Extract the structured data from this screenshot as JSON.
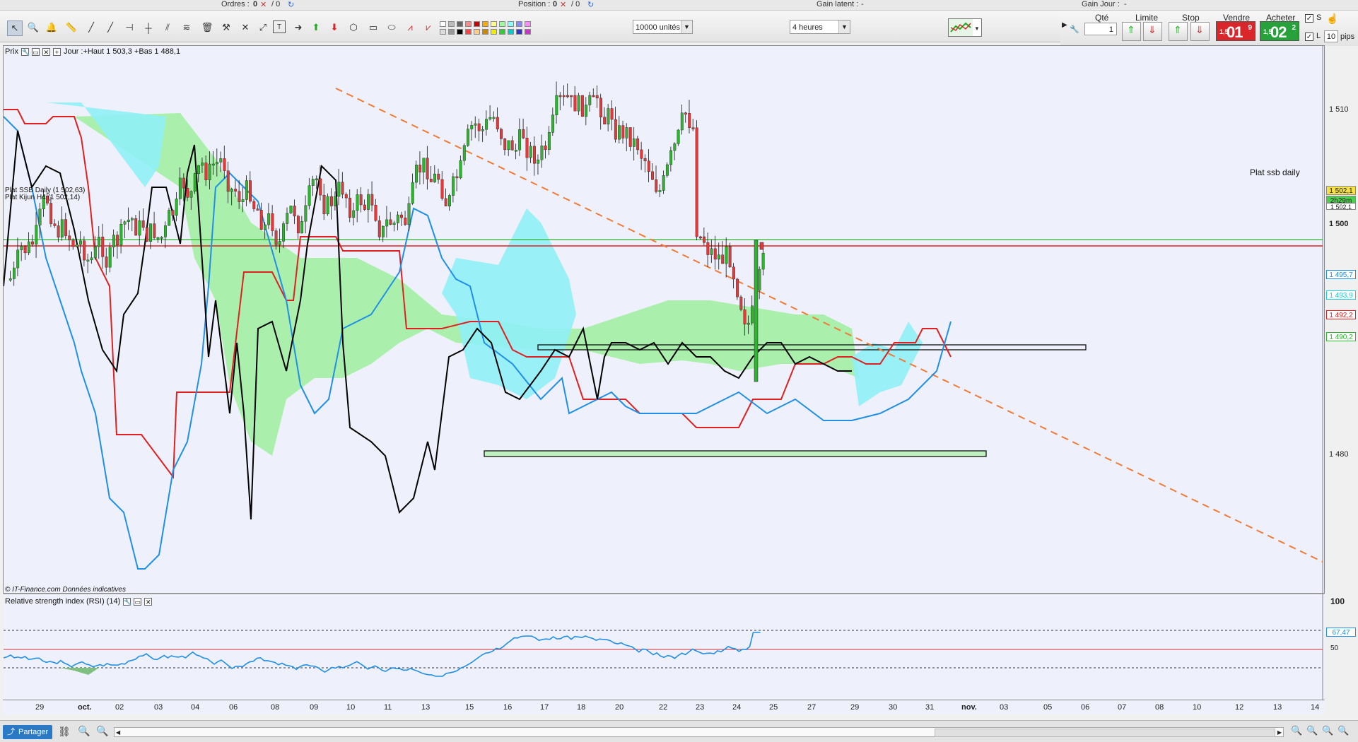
{
  "topbar": {
    "orders": "Ordres :",
    "orders_val": "0",
    "orders_of": "/ 0",
    "position": "Position :",
    "position_val": "0",
    "position_of": "/ 0",
    "gain_latent": "Gain latent :",
    "gain_latent_val": "-",
    "gain_jour": "Gain Jour :",
    "gain_jour_val": "-"
  },
  "toolbar": {
    "units": "10000 unités",
    "period": "4 heures"
  },
  "order_panel": {
    "qty_label": "Qté",
    "qty_value": "1",
    "limit_label": "Limite",
    "stop_label": "Stop",
    "sell_label": "Vendre",
    "buy_label": "Acheter",
    "sell_small": "1,5",
    "sell_big": "01",
    "sell_sup": "9",
    "buy_small": "1,5",
    "buy_big": "02",
    "buy_sup": "2",
    "s_label": "S",
    "l_label": "L",
    "pips_value": "10",
    "pips_label": "pips"
  },
  "chart": {
    "legend_name": "Prix",
    "legend_info": "Jour :+Haut 1 503,3 +Bas 1 488,1",
    "line1_label": "Plat SSB Daily (1 502,63)",
    "line2_label": "Plat Kijun H4 (1 502,14)",
    "annotation": "Plat ssb daily",
    "source": "© IT-Finance.com  Données indicatives",
    "y_ticks": [
      "1 510",
      "1 500",
      "1 480"
    ],
    "tags": {
      "price": "1 502,1",
      "timer": "2h29m",
      "t3": "1 502,1",
      "t4": "1 495,7",
      "t5": "1 493,9",
      "t6": "1 492,2",
      "t7": "1 490,2"
    },
    "colors": {
      "up": "#2db52d",
      "down": "#e23a3a",
      "kijun": "#e02020",
      "tenkan": "#1f8fe8",
      "chikou": "#000000",
      "cloud_up": "#9ef09e",
      "cloud_down": "#8ff0f5",
      "trend": "#f07a36"
    }
  },
  "rsi": {
    "label": "Relative strength index (RSI) (14)",
    "ticks": [
      "100",
      "50"
    ],
    "value": "67,47"
  },
  "xaxis": [
    "29",
    "oct.",
    "02",
    "03",
    "04",
    "06",
    "08",
    "09",
    "10",
    "11",
    "13",
    "15",
    "16",
    "17",
    "18",
    "20",
    "22",
    "23",
    "24",
    "25",
    "27",
    "29",
    "30",
    "31",
    "nov.",
    "03",
    "05",
    "06",
    "07",
    "08",
    "10",
    "12",
    "13",
    "14"
  ],
  "bottom": {
    "share": "Partager"
  }
}
